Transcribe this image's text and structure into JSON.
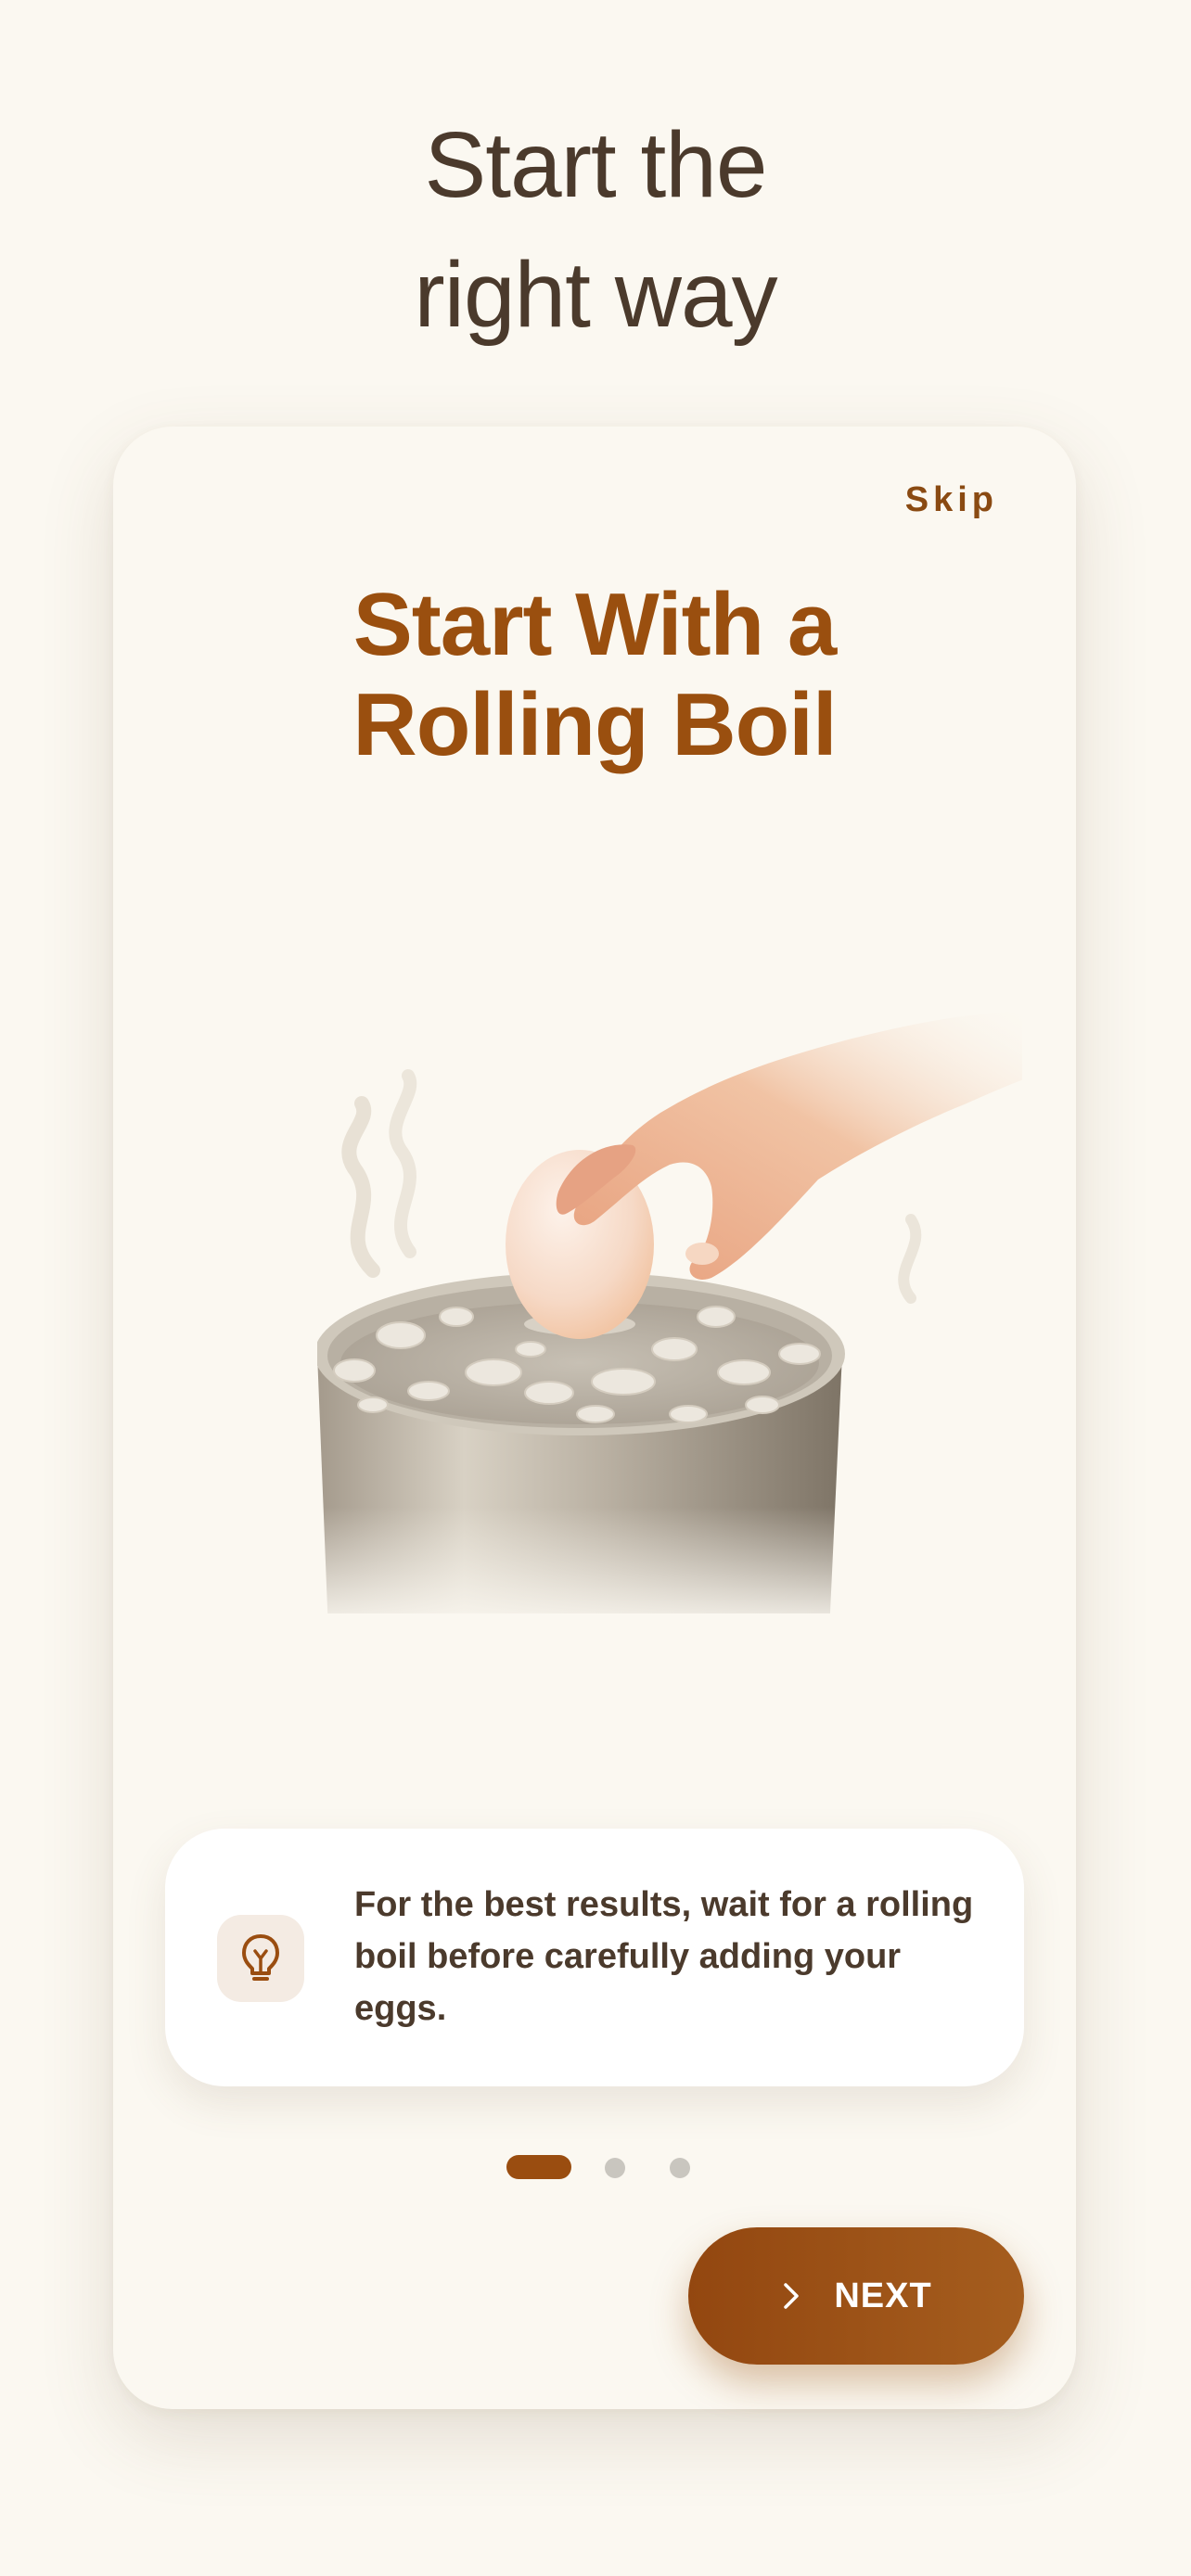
{
  "header": {
    "title_line1": "Start the",
    "title_line2": "right way"
  },
  "card": {
    "skip_label": "Skip",
    "title_line1": "Start With a",
    "title_line2": "Rolling Boil",
    "illustration": "hand-lowering-egg-into-boiling-pot",
    "tip": {
      "icon": "lightbulb-icon",
      "text": "For the best results, wait for a rolling boil before carefully adding your eggs."
    },
    "pagination": {
      "total": 3,
      "current": 1
    },
    "next_label": "NEXT",
    "next_icon": "chevron-right-icon"
  },
  "colors": {
    "background": "#fbf8f1",
    "accent": "#9a4f0f",
    "text_dark": "#4b3a2c",
    "dot_inactive": "#c9c6bf"
  }
}
